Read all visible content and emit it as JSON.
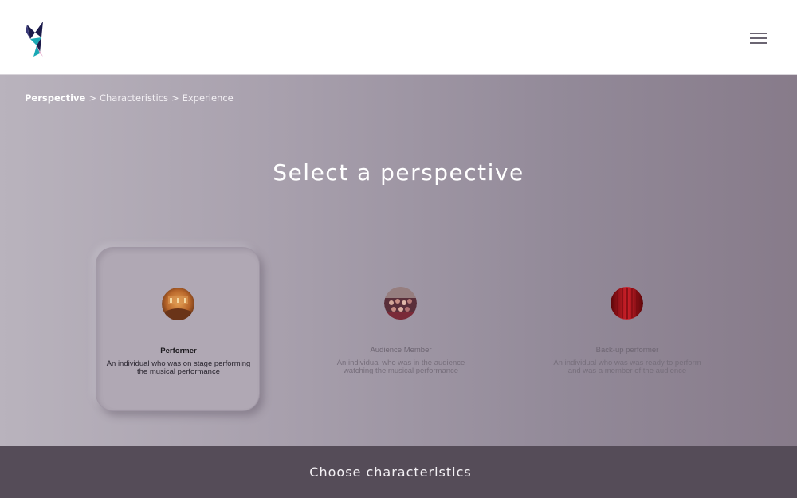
{
  "header": {
    "logo_icon": "fractured-triangle-logo",
    "menu_icon": "hamburger-menu-icon"
  },
  "breadcrumb": {
    "items": [
      "Perspective",
      "Characteristics",
      "Experience"
    ],
    "separator": ">"
  },
  "page": {
    "title": "Select a perspective"
  },
  "cards": [
    {
      "title": "Performer",
      "description": "An individual who was on stage performing the musical performance",
      "selected": true,
      "image_icon": "concert-hall-photo"
    },
    {
      "title": "Audience Member",
      "description": "An individual who was in the audience watching the musical performance",
      "selected": false,
      "image_icon": "audience-photo"
    },
    {
      "title": "Back-up performer",
      "description": "An individual who was was ready to perform and was a member of the audience",
      "selected": false,
      "image_icon": "red-curtain-photo"
    }
  ],
  "footer": {
    "button_label": "Choose characteristics"
  },
  "colors": {
    "footer_bg": "#554c58",
    "main_gradient_start": "#b9b3bd",
    "main_gradient_end": "#877b8a",
    "logo_navy": "#1b1b4b",
    "logo_teal": "#1aa9b5",
    "logo_pink": "#e0a3c8"
  }
}
